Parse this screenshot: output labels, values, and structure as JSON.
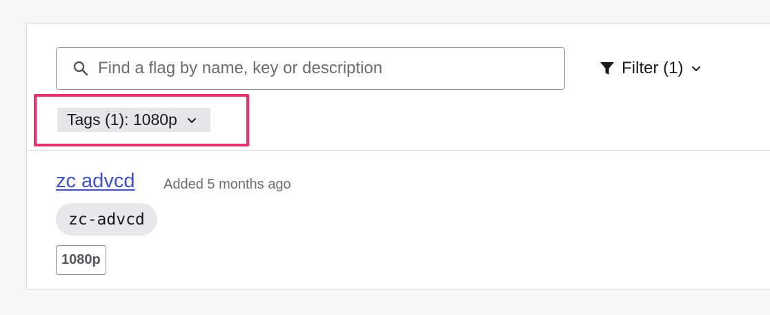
{
  "search": {
    "placeholder": "Find a flag by name, key or description",
    "value": ""
  },
  "filter": {
    "label": "Filter (1)",
    "icon": "funnel-icon"
  },
  "tags_filter": {
    "label": "Tags (1): 1080p",
    "highlight_color": "#ee2d6e"
  },
  "flags": [
    {
      "name": "zc advcd",
      "added": "Added 5 months ago",
      "key": "zc-advcd",
      "tags": [
        "1080p"
      ]
    }
  ],
  "colors": {
    "link": "#3c4fd6",
    "highlight": "#ee2d6e"
  }
}
